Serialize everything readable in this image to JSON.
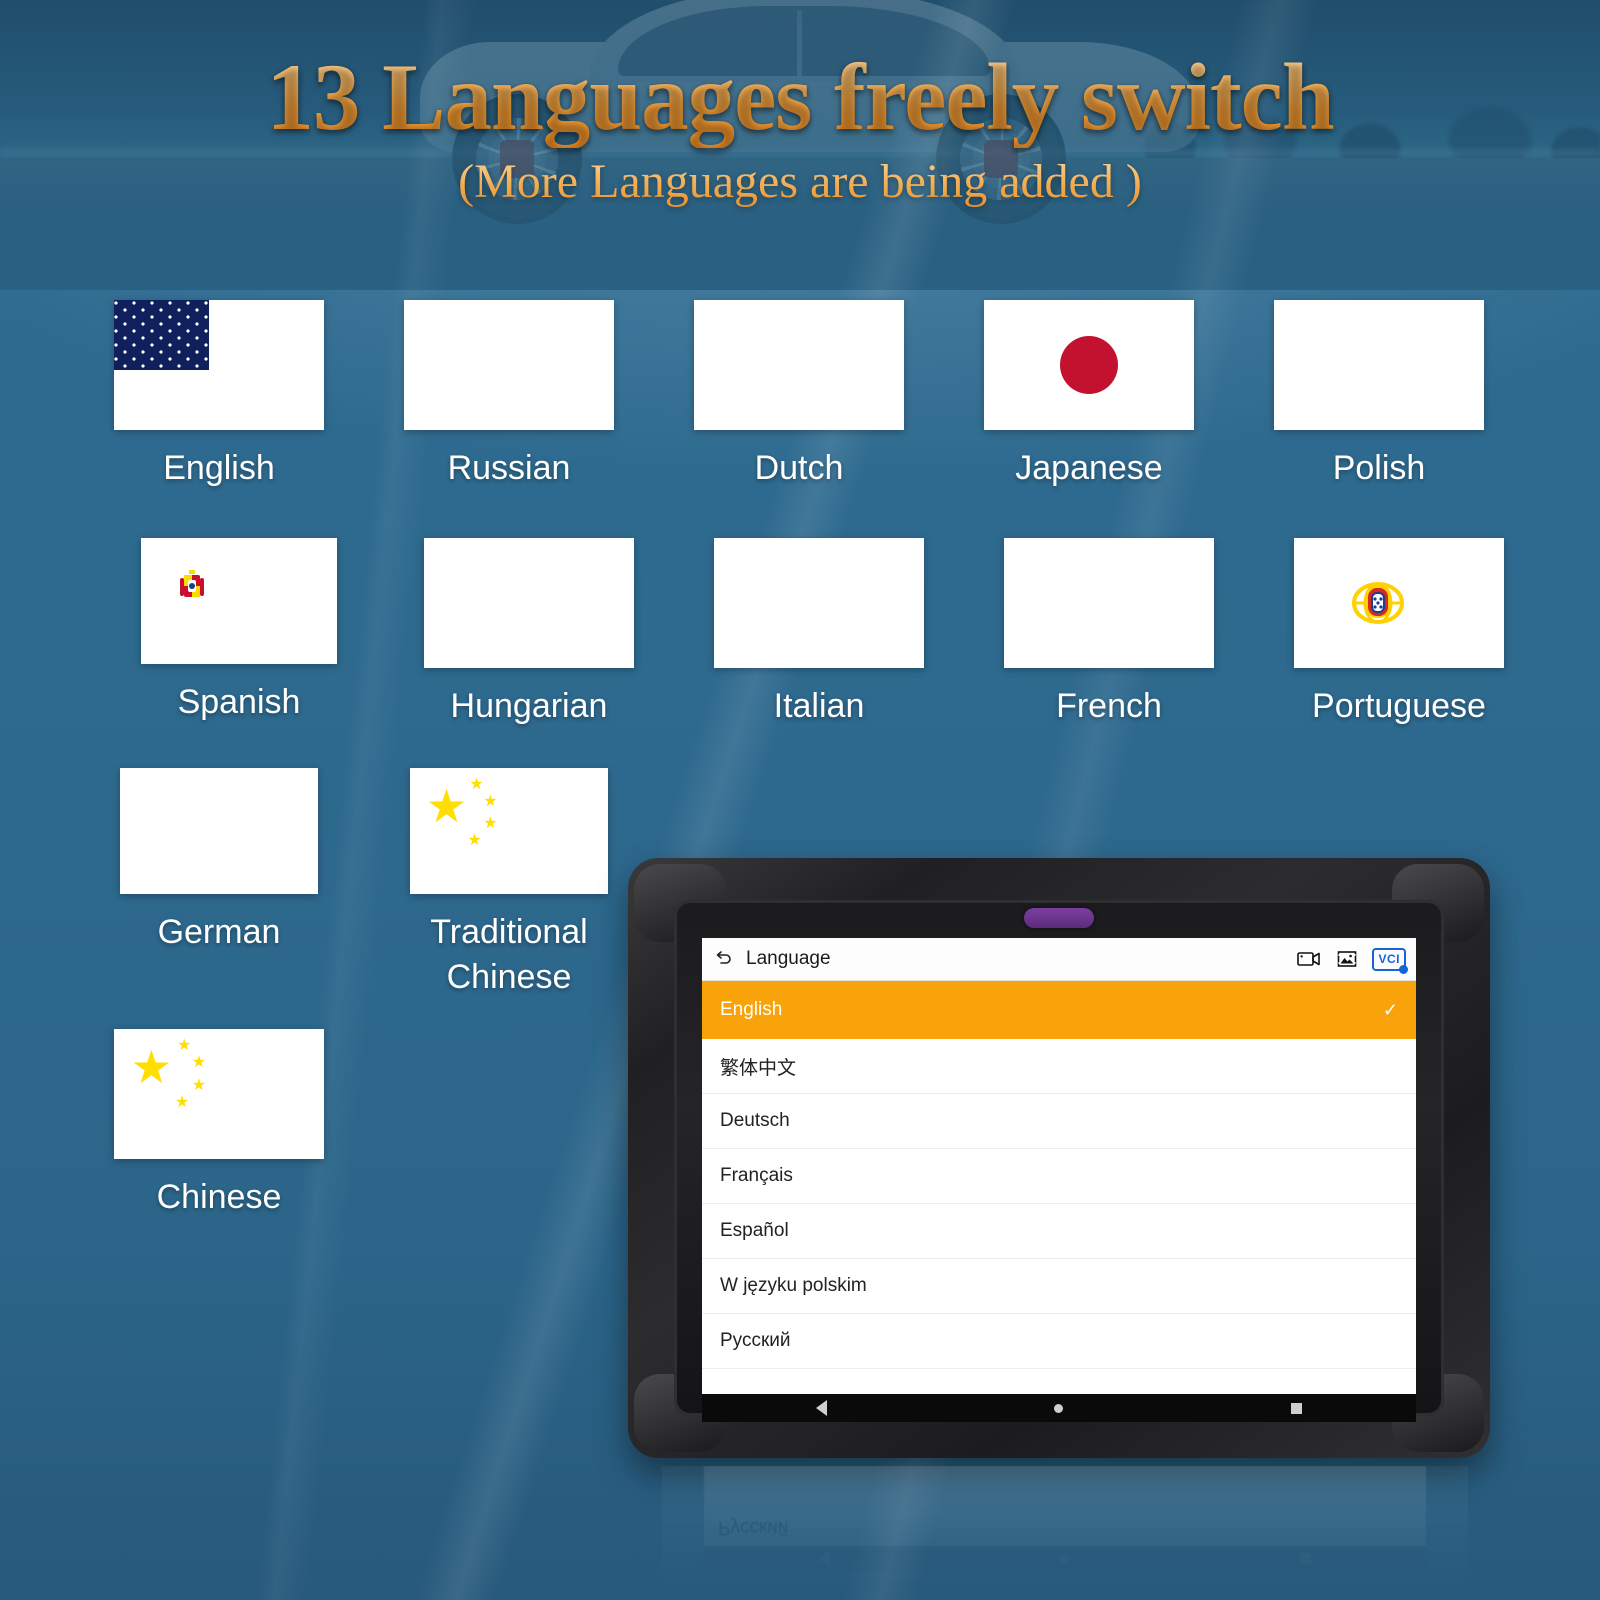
{
  "poster": {
    "headline": "13 Languages freely switch",
    "subhead": "(More Languages are being added )",
    "accent_orange": "#f2a13a",
    "background_blue": "#2d688d"
  },
  "languages": [
    {
      "name": "English",
      "flag": "flag-united-states"
    },
    {
      "name": "Russian",
      "flag": "flag-russia"
    },
    {
      "name": "Dutch",
      "flag": "flag-netherlands"
    },
    {
      "name": "Japanese",
      "flag": "flag-japan"
    },
    {
      "name": "Polish",
      "flag": "flag-poland"
    },
    {
      "name": "Spanish",
      "flag": "flag-spain"
    },
    {
      "name": "Hungarian",
      "flag": "flag-hungary"
    },
    {
      "name": "Italian",
      "flag": "flag-italy"
    },
    {
      "name": "French",
      "flag": "flag-france"
    },
    {
      "name": "Portuguese",
      "flag": "flag-portugal"
    },
    {
      "name": "German",
      "flag": "flag-germany"
    },
    {
      "name": "Traditional\nChinese",
      "flag": "flag-china"
    },
    {
      "name": "Chinese",
      "flag": "flag-china"
    }
  ],
  "device": {
    "appbar": {
      "back_icon": "back-arrow-icon",
      "title": "Language",
      "icons": [
        "video-camera-icon",
        "screenshot-image-icon",
        "vci-badge-icon"
      ],
      "vci_label": "VCI"
    },
    "selected_language": "English",
    "check_mark": "✓",
    "list": [
      {
        "label": "English",
        "selected": true
      },
      {
        "label": "繁体中文",
        "selected": false
      },
      {
        "label": "Deutsch",
        "selected": false
      },
      {
        "label": "Français",
        "selected": false
      },
      {
        "label": "Español",
        "selected": false
      },
      {
        "label": "W języku polskim",
        "selected": false
      },
      {
        "label": "Русский",
        "selected": false
      }
    ],
    "navbar": [
      "back-triangle-icon",
      "home-circle-icon",
      "recents-square-icon"
    ],
    "highlight_color": "#f7a309"
  },
  "reflection": {
    "mirrored_text": "Русский"
  }
}
